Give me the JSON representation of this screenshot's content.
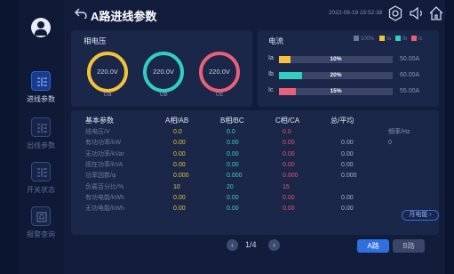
{
  "header": {
    "back_icon": "back-arrow-icon",
    "title": "A路进线参数",
    "datetime": "2022-08-19 15:52:38",
    "icons": [
      "gear-icon",
      "speaker-icon",
      "home-icon"
    ]
  },
  "sidebar": {
    "items": [
      {
        "label": "进线参数",
        "icon": "list-icon",
        "active": true
      },
      {
        "label": "出线参数",
        "icon": "list-icon",
        "active": false
      },
      {
        "label": "开关状态",
        "icon": "list-icon",
        "active": false
      },
      {
        "label": "报警查询",
        "icon": "alarm-icon",
        "active": false
      }
    ]
  },
  "phase_voltage": {
    "title": "相电压",
    "gauges": [
      {
        "value": "220.0V",
        "label": "Ua",
        "color": "#f2c33a"
      },
      {
        "value": "220.0V",
        "label": "Ub",
        "color": "#2fcfc3"
      },
      {
        "value": "220.0V",
        "label": "Uc",
        "color": "#e8607a"
      }
    ]
  },
  "current": {
    "title": "电流",
    "legend": [
      {
        "label": "100%",
        "color": "#6b7690"
      },
      {
        "label": "Ia",
        "color": "#f2c33a"
      },
      {
        "label": "Ib",
        "color": "#2fcfc3"
      },
      {
        "label": "Ic",
        "color": "#e8607a"
      }
    ],
    "bars": [
      {
        "label": "Ia",
        "percent": "10%",
        "fraction": 0.1,
        "max": "50.00A",
        "color": "#f2c33a"
      },
      {
        "label": "Ib",
        "percent": "20%",
        "fraction": 0.2,
        "max": "60.00A",
        "color": "#2fcfc3"
      },
      {
        "label": "Ic",
        "percent": "15%",
        "fraction": 0.15,
        "max": "55.00A",
        "color": "#e8607a"
      }
    ]
  },
  "table": {
    "headers": [
      "基本参数",
      "A相/AB",
      "B相/BC",
      "C相/CA",
      "总/平均",
      ""
    ],
    "rows": [
      [
        "线电压/V",
        "0.0",
        "0.0",
        "0.0",
        "",
        "频率/Hz"
      ],
      [
        "有功功率/kW",
        "0.00",
        "0.00",
        "0.00",
        "0.00",
        "0"
      ],
      [
        "无功功率/kVar",
        "0.00",
        "0.00",
        "0.00",
        "0.00",
        ""
      ],
      [
        "视在功率/kVA",
        "0.00",
        "0.00",
        "0.00",
        "0.00",
        ""
      ],
      [
        "功率因数/φ",
        "0.000",
        "0.000",
        "0.000",
        "0.000",
        ""
      ],
      [
        "负载百分比/%",
        "10",
        "20",
        "15",
        "",
        ""
      ],
      [
        "有功电能/kWh",
        "0.00",
        "0.00",
        "0.00",
        "0.00",
        ""
      ],
      [
        "无功电能/kWh",
        "0.00",
        "0.00",
        "0.00",
        "0.00",
        ""
      ]
    ],
    "month_energy_button": "月电能"
  },
  "pager": {
    "prev_icon": "chevron-left-icon",
    "next_icon": "chevron-right-icon",
    "page": "1/4"
  },
  "route_buttons": [
    {
      "label": "A路",
      "active": true
    },
    {
      "label": "B路",
      "active": false
    }
  ]
}
